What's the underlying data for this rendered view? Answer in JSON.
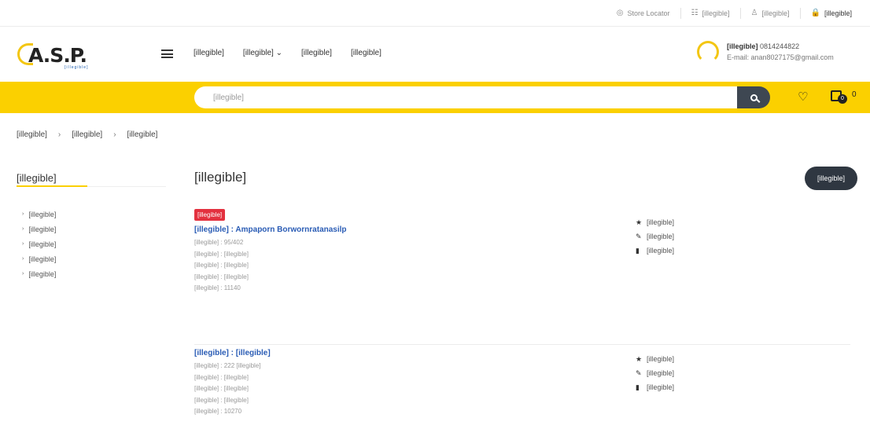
{
  "topbar": {
    "items": [
      {
        "icon": "location-pin-icon",
        "glyph": "◎",
        "label": "Store Locator"
      },
      {
        "icon": "track-order-icon",
        "glyph": "☷",
        "label": "[illegible]"
      },
      {
        "icon": "user-icon",
        "glyph": "♙",
        "label": "[illegible]"
      },
      {
        "icon": "lock-icon",
        "glyph": "🔒",
        "label": "[illegible]"
      }
    ]
  },
  "header": {
    "logo_text": "A.S.P.",
    "logo_sub": "[illegible]",
    "nav": [
      "[illegible]",
      "[illegible]",
      "[illegible]",
      "[illegible]"
    ],
    "contact_label": "[illegible]",
    "contact_phone": "0814244822",
    "contact_email": "E-mail: anan8027175@gmail.com"
  },
  "search": {
    "placeholder": "[illegible]",
    "cart_badge": "0",
    "cart_count": "0"
  },
  "breadcrumb": [
    "[illegible]",
    "[illegible]",
    "[illegible]"
  ],
  "sidebar": {
    "title": "[illegible]",
    "items": [
      "[illegible]",
      "[illegible]",
      "[illegible]",
      "[illegible]",
      "[illegible]"
    ]
  },
  "main": {
    "title": "[illegible]",
    "add_button": "[illegible]",
    "addresses": [
      {
        "badge": "[illegible]",
        "name": "[illegible] : Ampaporn Borwornratanasilp",
        "lines": [
          "[illegible] : 95/402",
          "[illegible] : [illegible]",
          "[illegible] : [illegible]",
          "[illegible] : [illegible]",
          "[illegible] : 11140"
        ],
        "actions": [
          "[illegible]",
          "[illegible]",
          "[illegible]"
        ]
      },
      {
        "badge": "",
        "name": "[illegible] : [illegible]",
        "lines": [
          "[illegible] : 222 [illegible]",
          "[illegible] : [illegible]",
          "[illegible] : [illegible]",
          "[illegible] : [illegible]",
          "[illegible] : 10270"
        ],
        "actions": [
          "[illegible]",
          "[illegible]",
          "[illegible]"
        ]
      }
    ]
  },
  "colors": {
    "accent_yellow": "#fbd000",
    "dark_button": "#2f3741",
    "badge_red": "#e3313f",
    "link_blue": "#2a5cb5"
  }
}
